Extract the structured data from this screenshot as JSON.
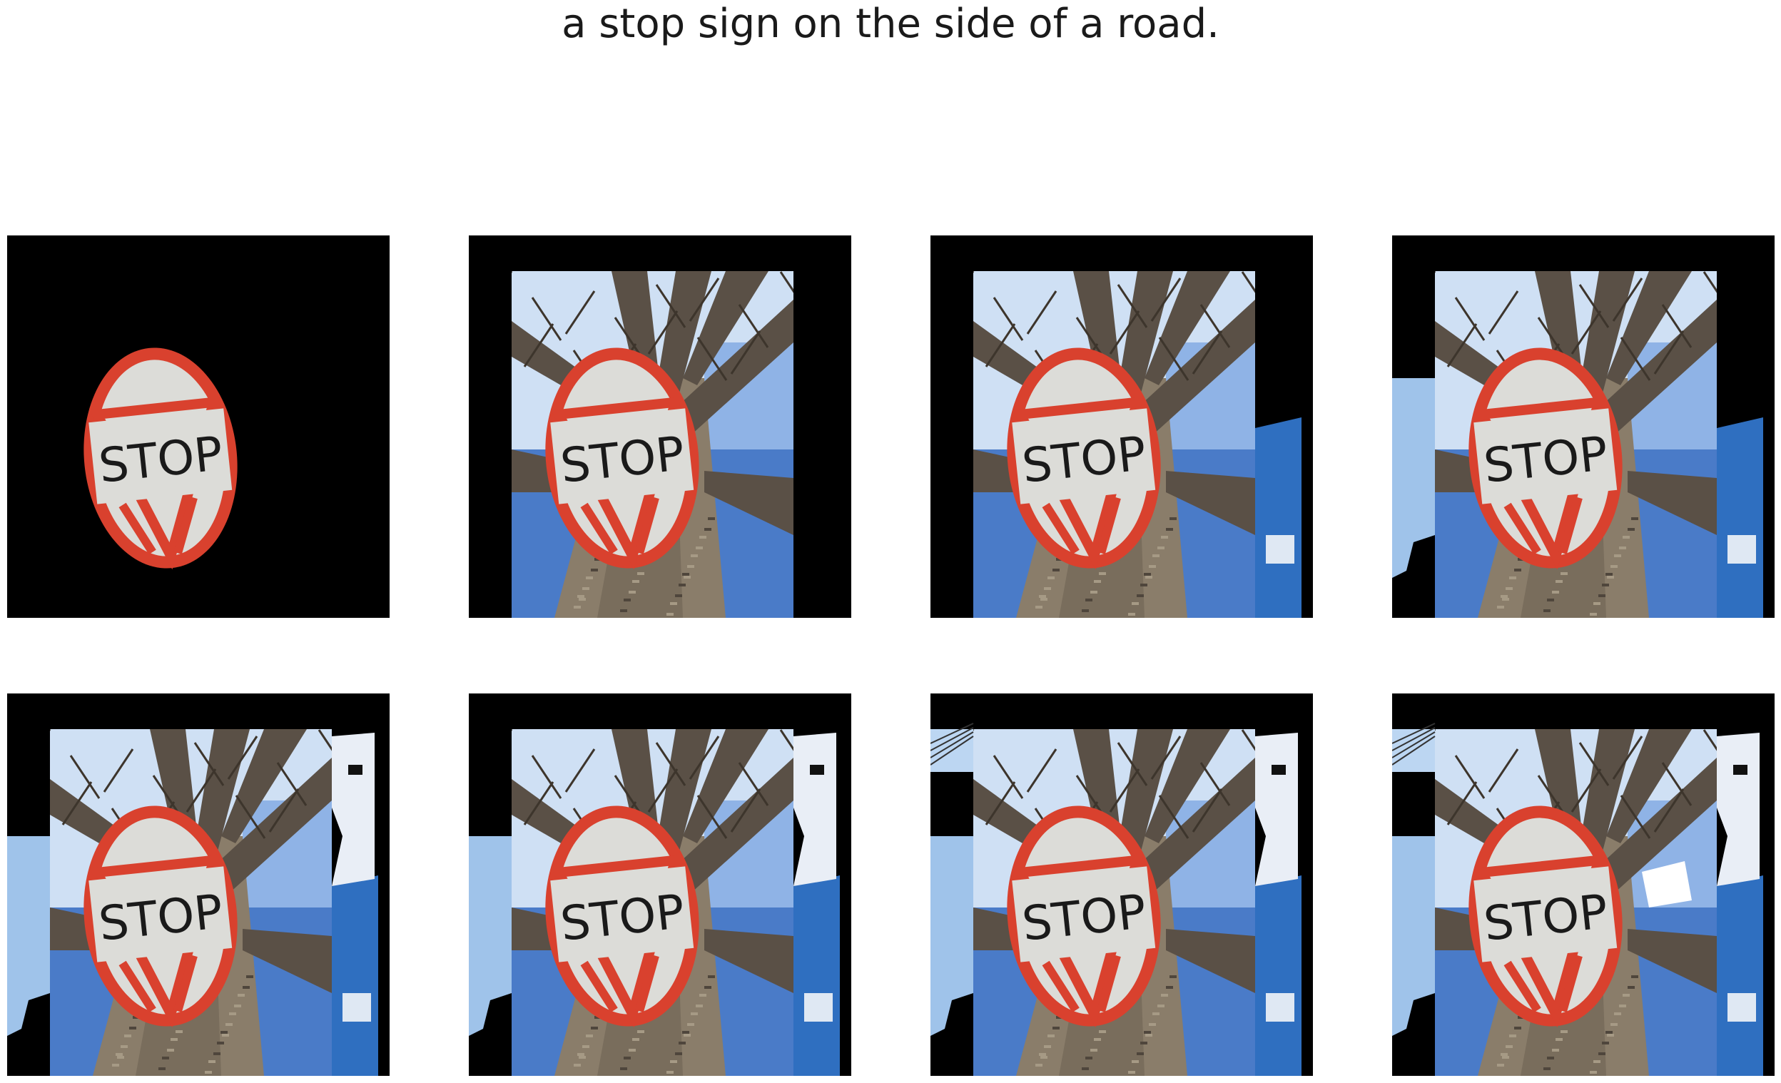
{
  "figure": {
    "caption": "a stop sign on the side of a road."
  },
  "sign": {
    "word": "STOP"
  },
  "panels": [
    {
      "id": 1,
      "revealed": []
    },
    {
      "id": 2,
      "revealed": [
        "tree"
      ]
    },
    {
      "id": 3,
      "revealed": [
        "tree",
        "sky-right"
      ]
    },
    {
      "id": 4,
      "revealed": [
        "tree",
        "sky-right",
        "sky-left"
      ]
    },
    {
      "id": 5,
      "revealed": [
        "tree",
        "sky-right",
        "sky-left",
        "top-right-patch"
      ]
    },
    {
      "id": 6,
      "revealed": [
        "tree",
        "sky-right",
        "sky-left",
        "top-right-patch"
      ]
    },
    {
      "id": 7,
      "revealed": [
        "tree",
        "sky-right",
        "sky-left",
        "top-right-patch",
        "top-left-wires"
      ]
    },
    {
      "id": 8,
      "revealed": [
        "tree",
        "sky-right",
        "sky-left",
        "top-right-patch",
        "top-left-wires",
        "white-gap"
      ]
    }
  ],
  "colors": {
    "background": "#000000",
    "sign_red": "#d9412e",
    "sign_face": "#dcdcd8",
    "sky": "#4a7bc8",
    "pale_sky": "#cfe0f4",
    "bark": "#8a7d6a"
  }
}
